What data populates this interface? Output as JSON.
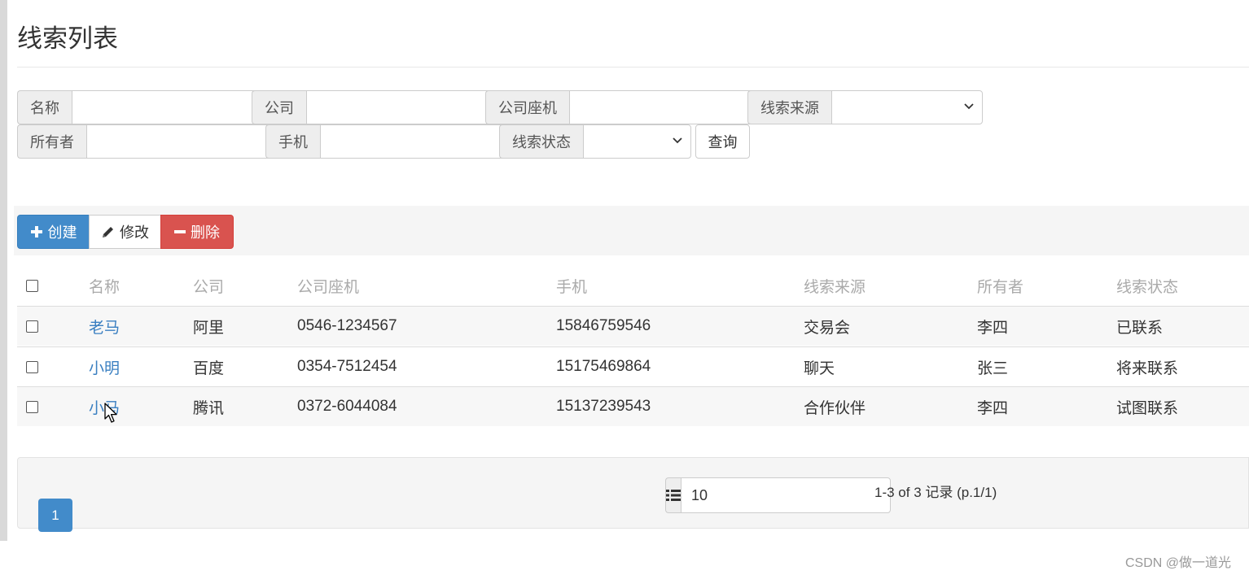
{
  "page": {
    "title": "线索列表"
  },
  "filters": {
    "name_label": "名称",
    "company_label": "公司",
    "phone_label": "公司座机",
    "source_label": "线索来源",
    "owner_label": "所有者",
    "mobile_label": "手机",
    "status_label": "线索状态",
    "search_label": "查询"
  },
  "toolbar": {
    "create_label": "创建",
    "edit_label": "修改",
    "delete_label": "删除"
  },
  "table": {
    "headers": [
      "名称",
      "公司",
      "公司座机",
      "手机",
      "线索来源",
      "所有者",
      "线索状态"
    ],
    "rows": [
      [
        "老马",
        "阿里",
        "0546-1234567",
        "15846759546",
        "交易会",
        "李四",
        "已联系"
      ],
      [
        "小明",
        "百度",
        "0354-7512454",
        "15175469864",
        "聊天",
        "张三",
        "将来联系"
      ],
      [
        "小马",
        "腾讯",
        "0372-6044084",
        "15137239543",
        "合作伙伴",
        "李四",
        "试图联系"
      ]
    ]
  },
  "pagination": {
    "current_page": "1",
    "page_size": "10",
    "info": "1-3 of 3 记录 (p.1/1)"
  },
  "watermark": "CSDN @做一道光",
  "colors": {
    "primary": "#428bca",
    "danger": "#d9534f",
    "link": "#3a7fc1"
  },
  "icons": [
    "plus-icon",
    "pencil-icon",
    "minus-icon",
    "list-icon",
    "chevron-down-icon",
    "mouse-cursor-icon"
  ]
}
